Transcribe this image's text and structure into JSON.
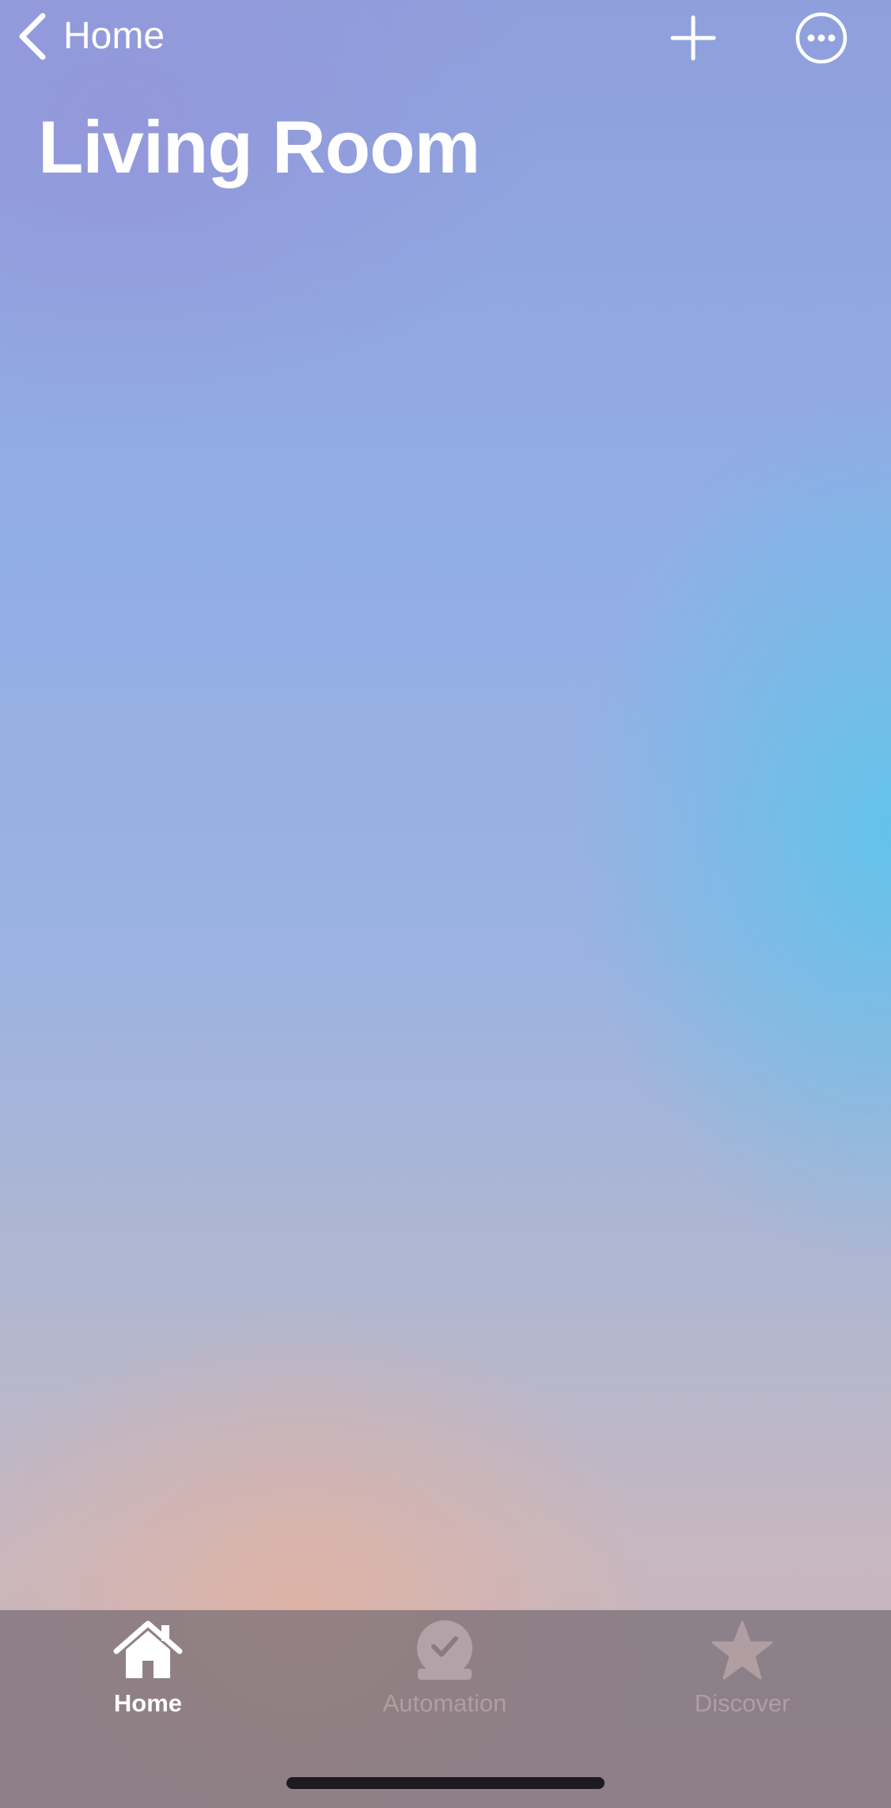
{
  "nav": {
    "back_label": "Home",
    "back_icon": "chevron-left-icon",
    "add_icon": "plus-icon",
    "more_icon": "ellipsis-circle-icon"
  },
  "room": {
    "title": "Living Room"
  },
  "tabbar": {
    "tabs": [
      {
        "label": "Home",
        "icon": "house-icon",
        "active": true
      },
      {
        "label": "Automation",
        "icon": "clock-check-icon",
        "active": false
      },
      {
        "label": "Discover",
        "icon": "star-icon",
        "active": false
      }
    ]
  },
  "colors": {
    "active_tab": "#ffffff",
    "inactive_tab": "#b09ea2",
    "tabbar_background": "#766c74",
    "home_indicator": "#1f1a22"
  }
}
